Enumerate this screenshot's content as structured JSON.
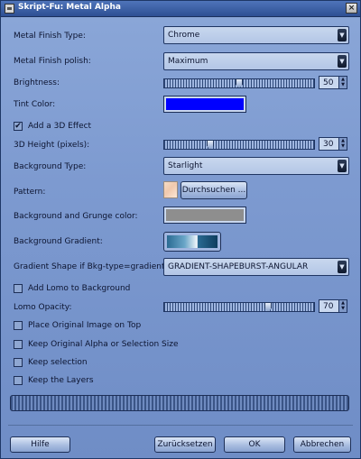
{
  "window": {
    "title": "Skript-Fu: Metal Alpha",
    "close_glyph": "×"
  },
  "fields": {
    "metal_finish_type": {
      "label": "Metal Finish Type:",
      "value": "Chrome"
    },
    "metal_finish_polish": {
      "label": "Metal Finish polish:",
      "value": "Maximum"
    },
    "brightness": {
      "label": "Brightness:",
      "value": "50",
      "min": 0,
      "max": 100
    },
    "tint_color": {
      "label": "Tint Color:",
      "color": "#0000ff"
    },
    "add_3d_effect": {
      "label": "Add a 3D Effect",
      "checked": true,
      "check_glyph": "✔"
    },
    "height_3d": {
      "label": "3D Height (pixels):",
      "value": "30",
      "min": 0,
      "max": 100
    },
    "background_type": {
      "label": "Background Type:",
      "value": "Starlight"
    },
    "pattern": {
      "label": "Pattern:",
      "button_label": "Durchsuchen ..."
    },
    "grunge_color": {
      "label": "Background and Grunge color:",
      "color": "#8e8e8e"
    },
    "background_gradient": {
      "label": "Background Gradient:"
    },
    "gradient_shape": {
      "label": "Gradient Shape if Bkg-type=gradient:",
      "value": "GRADIENT-SHAPEBURST-ANGULAR"
    },
    "add_lomo": {
      "label": "Add Lomo to Background",
      "checked": false
    },
    "lomo_opacity": {
      "label": "Lomo Opacity:",
      "value": "70",
      "min": 0,
      "max": 100
    },
    "place_on_top": {
      "label": "Place Original Image on Top",
      "checked": false
    },
    "keep_alpha": {
      "label": "Keep Original Alpha or Selection Size",
      "checked": false
    },
    "keep_selection": {
      "label": "Keep selection",
      "checked": false
    },
    "keep_layers": {
      "label": "Keep the Layers",
      "checked": false
    }
  },
  "icons": {
    "combo_arrow": "▼",
    "spin_up": "▲",
    "spin_down": "▼"
  },
  "buttons": {
    "help": "Hilfe",
    "reset": "Zurücksetzen",
    "ok": "OK",
    "cancel": "Abbrechen"
  }
}
